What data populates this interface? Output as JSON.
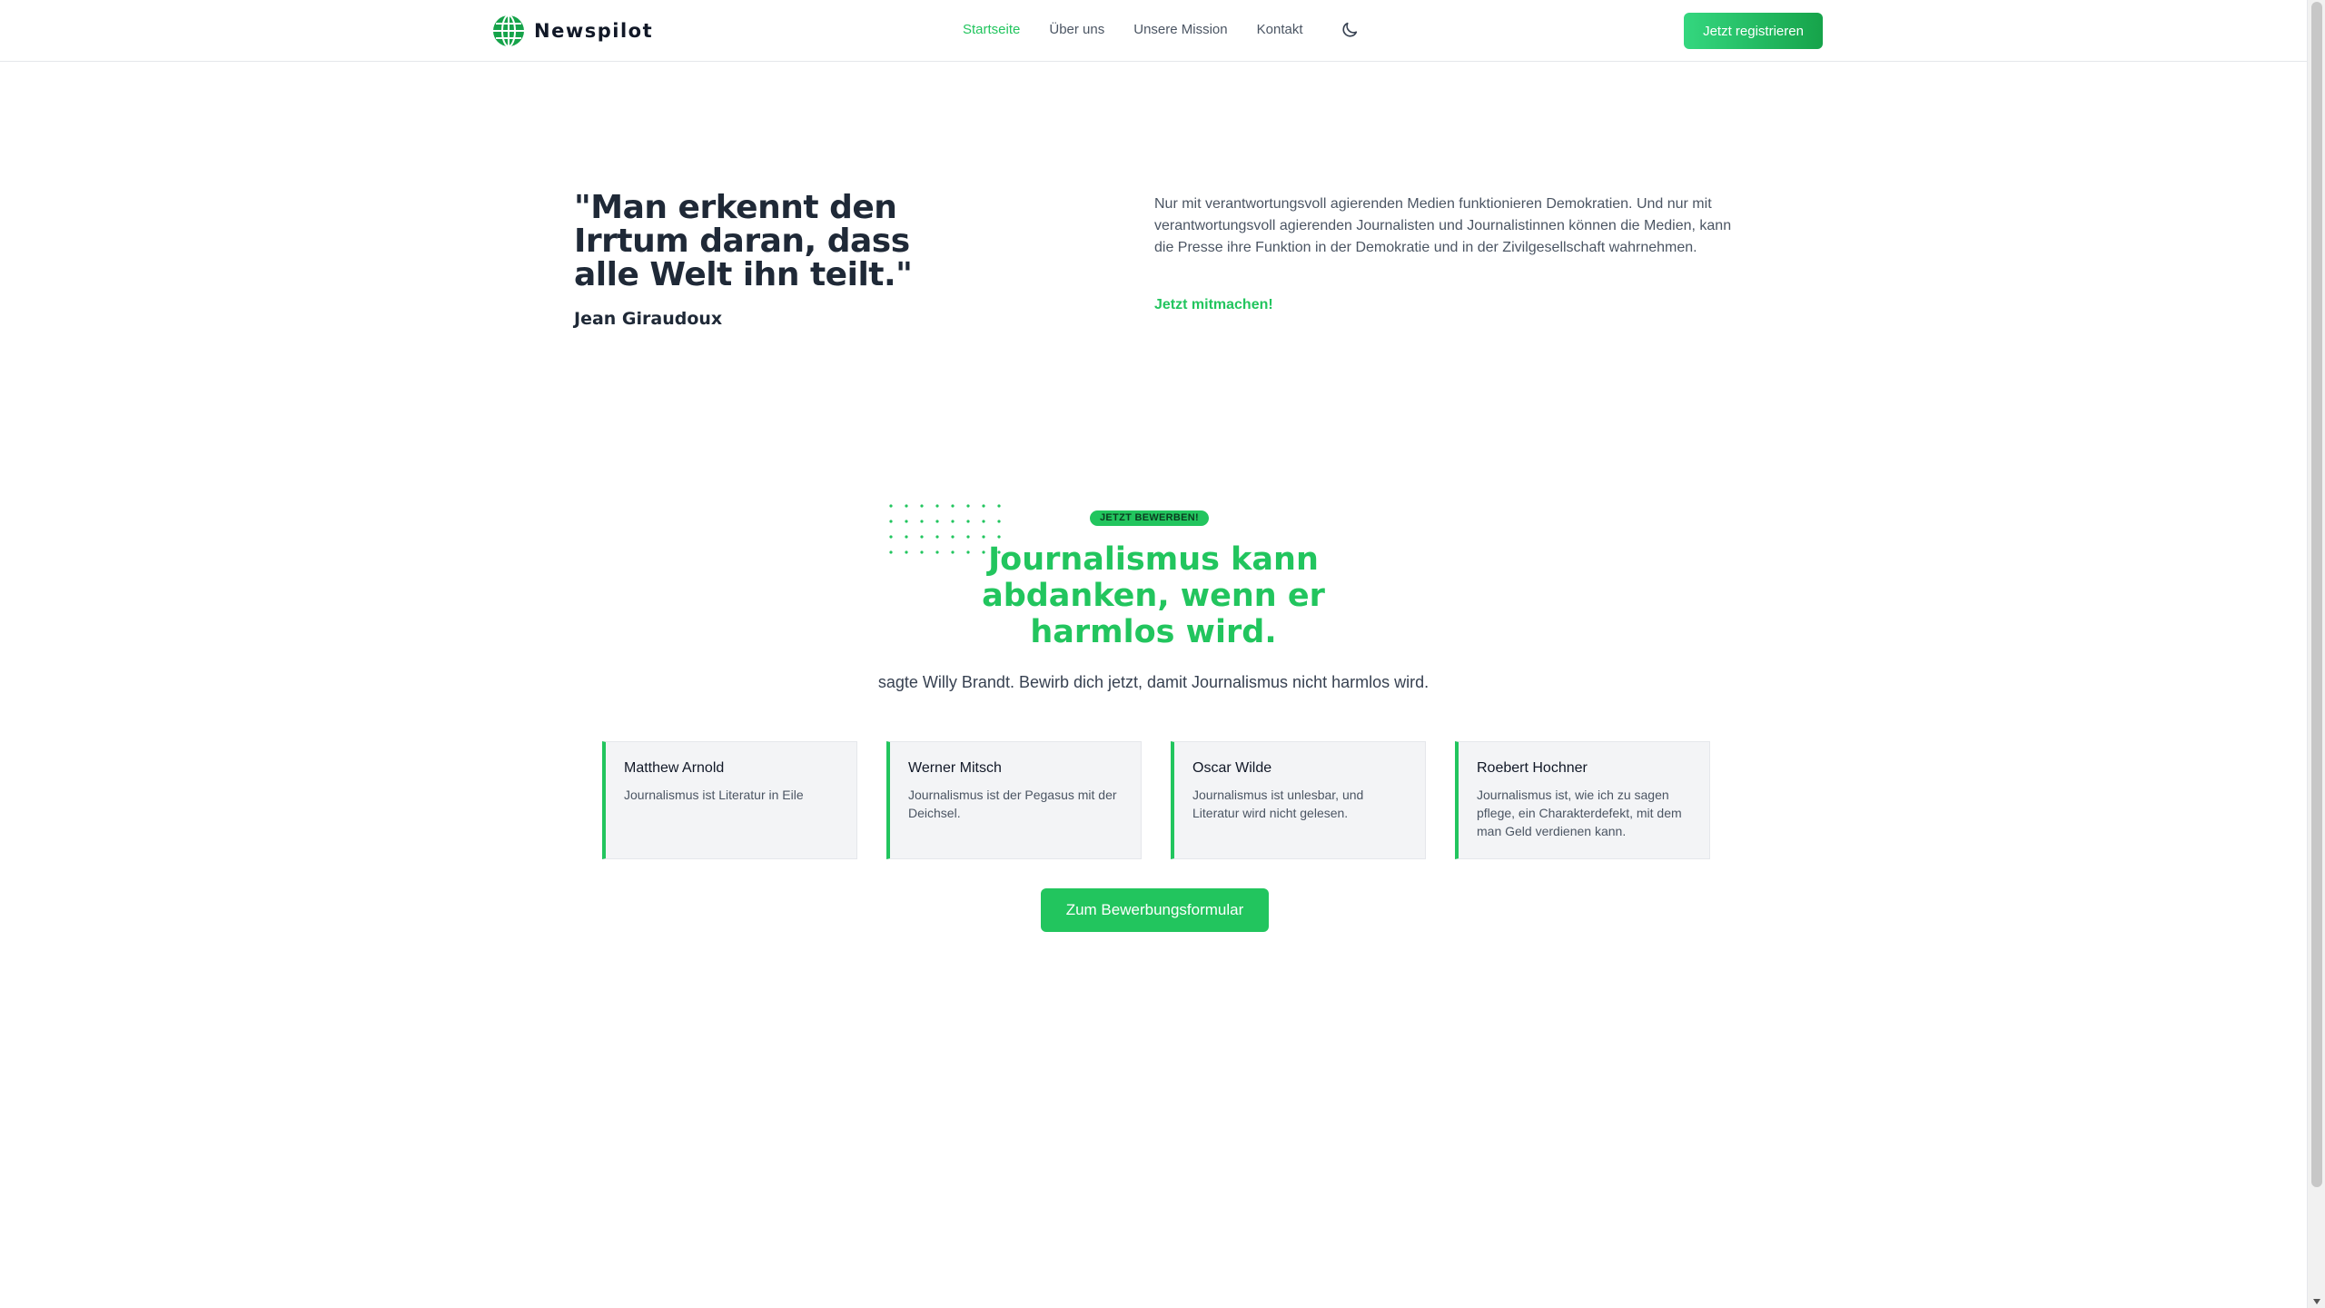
{
  "brand": {
    "name": "Newspilot",
    "logo_icon": "globe-icon"
  },
  "nav": {
    "items": [
      {
        "label": "Startseite",
        "active": true
      },
      {
        "label": "Über uns",
        "active": false
      },
      {
        "label": "Unsere Mission",
        "active": false
      },
      {
        "label": "Kontakt",
        "active": false
      }
    ],
    "theme_icon": "moon-icon"
  },
  "header_cta": {
    "label": "Jetzt registrieren"
  },
  "hero": {
    "quote": "\"Man erkennt den Irrtum daran, dass alle Welt ihn teilt.\"",
    "author": "Jean Giraudoux",
    "text": "Nur mit verantwortungsvoll agierenden Medien funktionieren Demokratien. Und nur mit verantwortungsvoll agierenden Journalisten und Journalistinnen können die Medien, kann die Presse ihre Funktion in der Demokratie und in der Zivilgesellschaft wahrnehmen.",
    "link": "Jetzt mitmachen!"
  },
  "recruit": {
    "badge": "JETZT BEWERBEN!",
    "title": "Journalismus kann abdanken, wenn er harmlos wird.",
    "subtitle": "sagte Willy Brandt. Bewirb dich jetzt, damit Journalismus nicht harmlos wird.",
    "cards": [
      {
        "name": "Matthew Arnold",
        "text": "Journalismus ist Literatur in Eile"
      },
      {
        "name": "Werner Mitsch",
        "text": "Journalismus ist der Pegasus mit der Deichsel."
      },
      {
        "name": "Oscar Wilde",
        "text": "Journalismus ist unlesbar, und Literatur wird nicht gelesen."
      },
      {
        "name": "Roebert Hochner",
        "text": "Journalismus ist, wie ich zu sagen pflege, ein Charakterdefekt, mit dem man Geld verdienen kann."
      }
    ],
    "cta": "Zum Bewerbungsformular"
  },
  "colors": {
    "accent": "#22c55e",
    "text_dark": "#1f2937",
    "text_muted": "#4b5563",
    "card_bg": "#f3f4f6"
  }
}
